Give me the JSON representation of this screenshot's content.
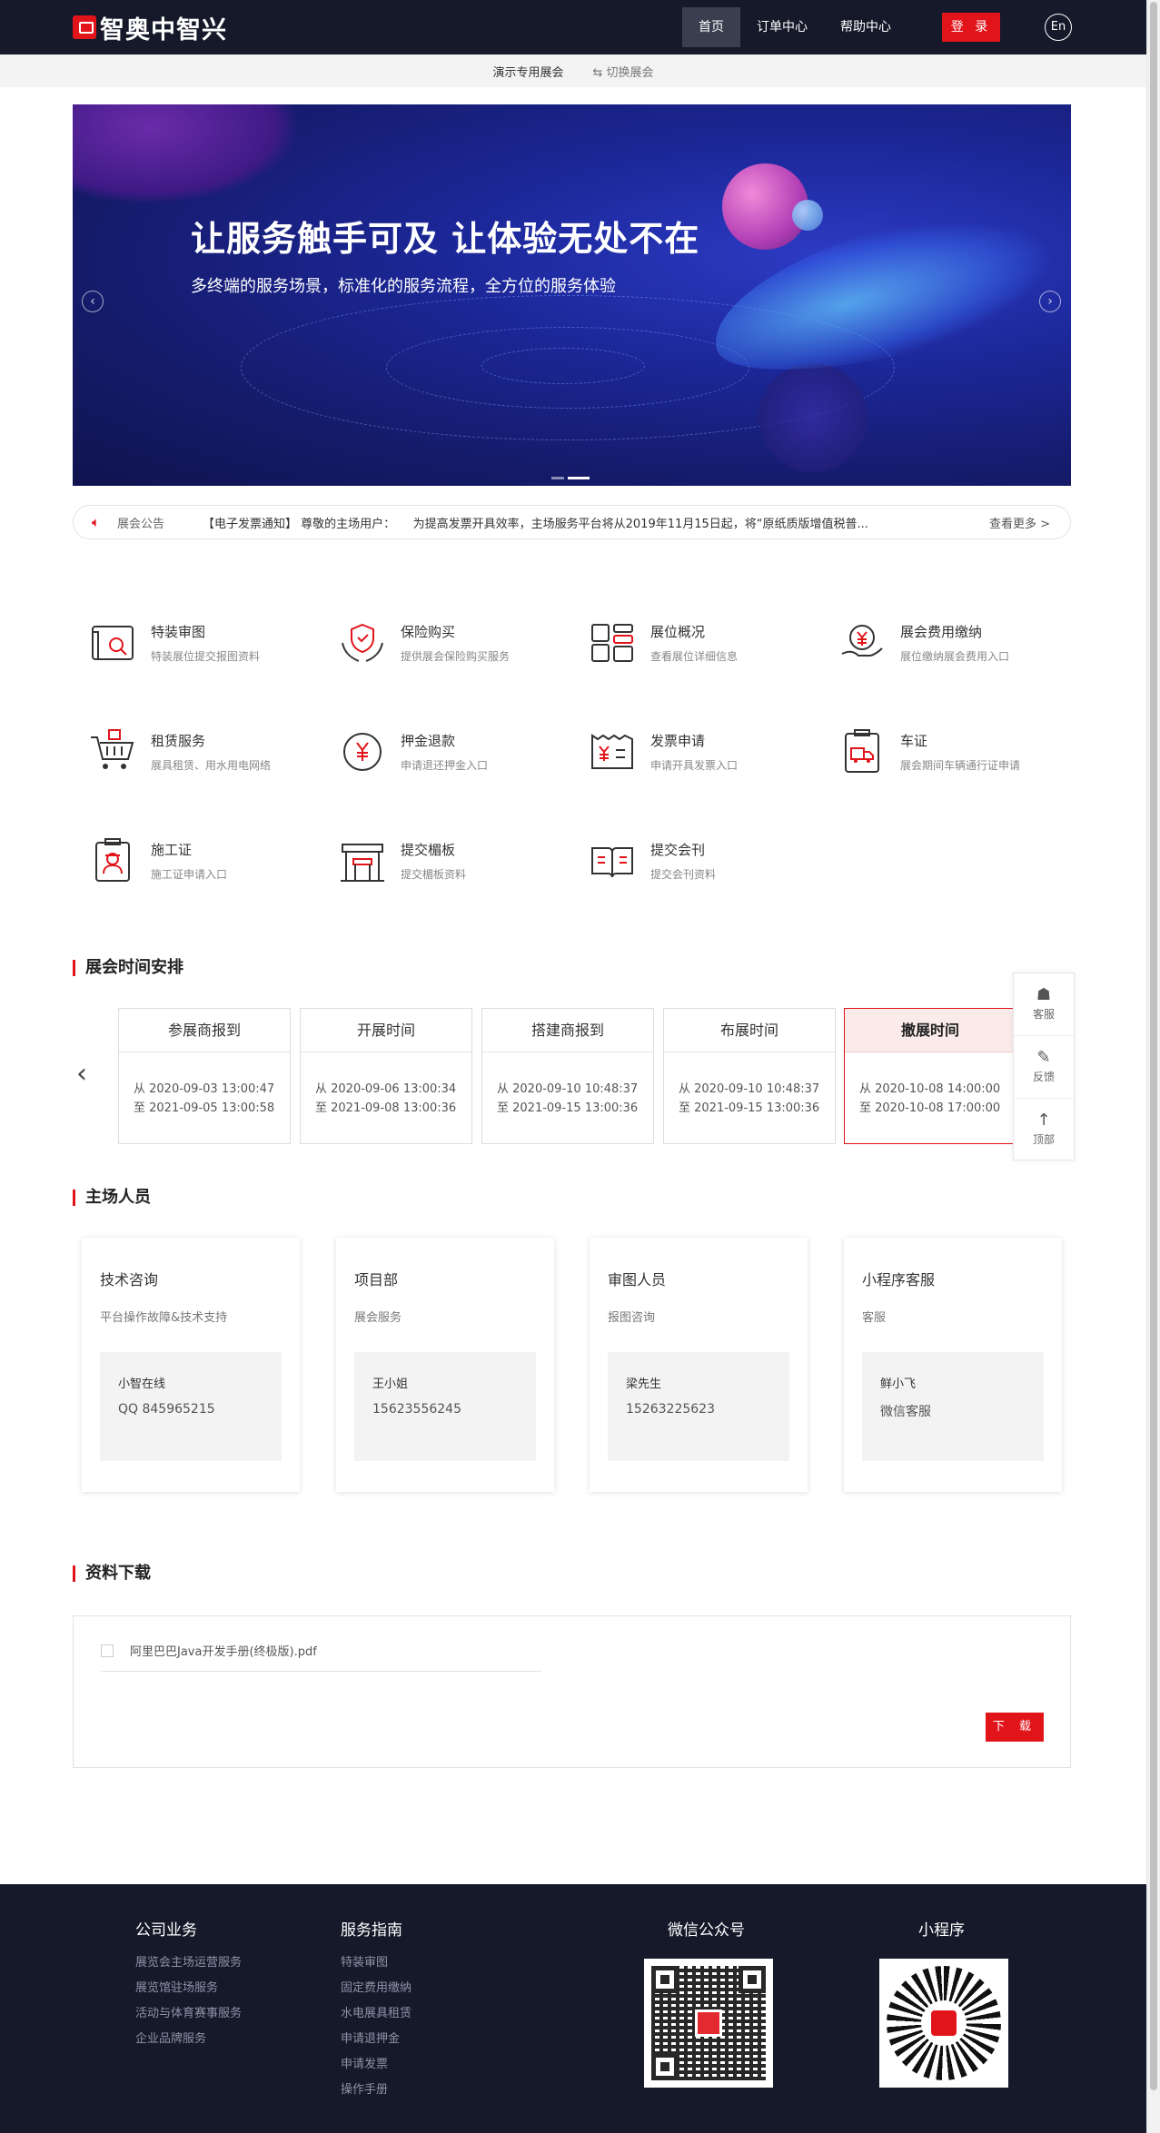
{
  "header": {
    "logo_text": "智奥中智兴",
    "nav": [
      "首页",
      "订单中心",
      "帮助中心"
    ],
    "login": "登 录",
    "lang": "En"
  },
  "subbar": {
    "demo": "演示专用展会",
    "switch": "⇆ 切换展会"
  },
  "banner": {
    "title": "让服务触手可及 让体验无处不在",
    "subtitle": "多终端的服务场景，标准化的服务流程，全方位的服务体验"
  },
  "notice": {
    "label": "展会公告",
    "text": "【电子发票通知】 尊敬的主场用户：　　为提高发票开具效率，主场服务平台将从2019年11月15日起，将“原纸质版增值税普...",
    "more": "查看更多 >"
  },
  "services": [
    {
      "title": "特装审图",
      "desc": "特装展位提交报图资料",
      "icon": "blueprint-icon"
    },
    {
      "title": "保险购买",
      "desc": "提供展会保险购买服务",
      "icon": "shield-hands-icon"
    },
    {
      "title": "展位概况",
      "desc": "查看展位详细信息",
      "icon": "grid-icon"
    },
    {
      "title": "展会费用缴纳",
      "desc": "展位缴纳展会费用入口",
      "icon": "yen-hand-icon"
    },
    {
      "title": "租赁服务",
      "desc": "展具租赁、用水用电网络",
      "icon": "cart-icon"
    },
    {
      "title": "押金退款",
      "desc": "申请退还押金入口",
      "icon": "yen-circle-icon"
    },
    {
      "title": "发票申请",
      "desc": "申请开具发票入口",
      "icon": "invoice-icon"
    },
    {
      "title": "车证",
      "desc": "展会期间车辆通行证申请",
      "icon": "truck-pass-icon"
    },
    {
      "title": "施工证",
      "desc": "施工证申请入口",
      "icon": "worker-pass-icon"
    },
    {
      "title": "提交楣板",
      "desc": "提交楣板资料",
      "icon": "fascia-board-icon"
    },
    {
      "title": "提交会刊",
      "desc": "提交会刊资料",
      "icon": "catalog-book-icon"
    }
  ],
  "schedule": {
    "title": "展会时间安排",
    "items": [
      {
        "name": "参展商报到",
        "from": "从 2020-09-03 13:00:47",
        "to": "至 2021-09-05 13:00:58"
      },
      {
        "name": "开展时间",
        "from": "从 2020-09-06 13:00:34",
        "to": "至 2021-09-08 13:00:36"
      },
      {
        "name": "搭建商报到",
        "from": "从 2020-09-10 10:48:37",
        "to": "至 2021-09-15 13:00:36"
      },
      {
        "name": "布展时间",
        "from": "从 2020-09-10 10:48:37",
        "to": "至 2021-09-15 13:00:36"
      },
      {
        "name": "撤展时间",
        "from": "从 2020-10-08 14:00:00",
        "to": "至 2020-10-08 17:00:00"
      }
    ]
  },
  "side_tools": [
    "客服",
    "反馈",
    "顶部"
  ],
  "staff": {
    "title": "主场人员",
    "items": [
      {
        "role": "技术咨询",
        "desc": "平台操作故障&技术支持",
        "name": "小智在线",
        "contact": "QQ 845965215"
      },
      {
        "role": "项目部",
        "desc": "展会服务",
        "name": "王小姐",
        "contact": "15623556245"
      },
      {
        "role": "审图人员",
        "desc": "报图咨询",
        "name": "梁先生",
        "contact": "15263225623"
      },
      {
        "role": "小程序客服",
        "desc": "客服",
        "name": "鲜小飞",
        "contact": "微信客服"
      }
    ]
  },
  "downloads": {
    "title": "资料下载",
    "file": "阿里巴巴Java开发手册(终极版).pdf",
    "button": "下 载"
  },
  "footer": {
    "col1": {
      "title": "公司业务",
      "links": [
        "展览会主场运营服务",
        "展览馆驻场服务",
        "活动与体育赛事服务",
        "企业品牌服务"
      ]
    },
    "col2": {
      "title": "服务指南",
      "links": [
        "特装审图",
        "固定费用缴纳",
        "水电展具租赁",
        "申请退押金",
        "申请发票",
        "操作手册"
      ]
    },
    "wechat": "微信公众号",
    "miniprogram": "小程序"
  }
}
